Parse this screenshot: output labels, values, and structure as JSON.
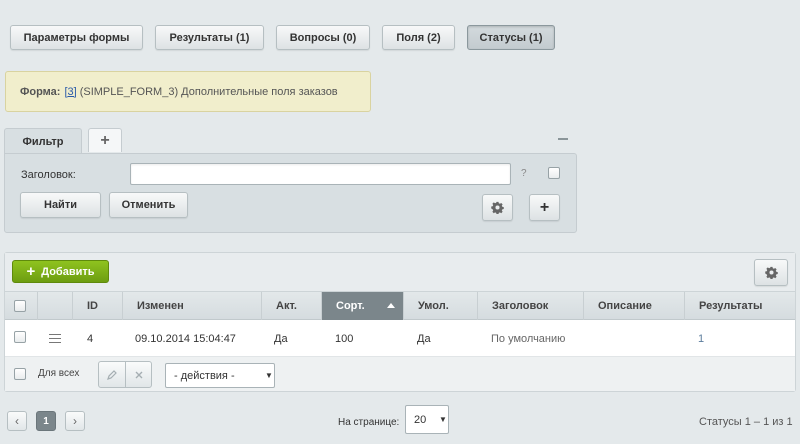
{
  "tabs": [
    {
      "label": "Параметры формы"
    },
    {
      "label": "Результаты (1)"
    },
    {
      "label": "Вопросы (0)"
    },
    {
      "label": "Поля (2)"
    },
    {
      "label": "Статусы (1)",
      "active": true
    }
  ],
  "notice": {
    "label": "Форма:",
    "id_link": "[3]",
    "text": "(SIMPLE_FORM_3) Дополнительные поля заказов"
  },
  "filter": {
    "tab_label": "Фильтр",
    "add_tab_icon": "+",
    "field_label": "Заголовок:",
    "field_value": "",
    "help": "?",
    "find_button": "Найти",
    "cancel_button": "Отменить",
    "add_button_icon": "+"
  },
  "list": {
    "add_button": "Добавить",
    "add_icon": "+",
    "columns": [
      "ID",
      "Изменен",
      "Акт.",
      "Сорт.",
      "Умол.",
      "Заголовок",
      "Описание",
      "Результаты"
    ],
    "sorted_column": "Сорт.",
    "rows": [
      {
        "id": "4",
        "changed": "09.10.2014 15:04:47",
        "active": "Да",
        "sort": "100",
        "default": "Да",
        "title": "По умолчанию",
        "description": "",
        "results": "1"
      }
    ],
    "footer": {
      "select_all_label": "Для всех",
      "actions_select": "- действия -"
    }
  },
  "pagination": {
    "prev": "‹",
    "current_page": "1",
    "next": "›",
    "per_page_label": "На странице:",
    "per_page_value": "20",
    "summary": "Статусы 1 – 1 из 1"
  },
  "colors": {
    "background": "#e4e9eb",
    "add_button": "#7fb418",
    "sorted_header": "#7b868b",
    "notice_bg": "#f1eecc"
  }
}
